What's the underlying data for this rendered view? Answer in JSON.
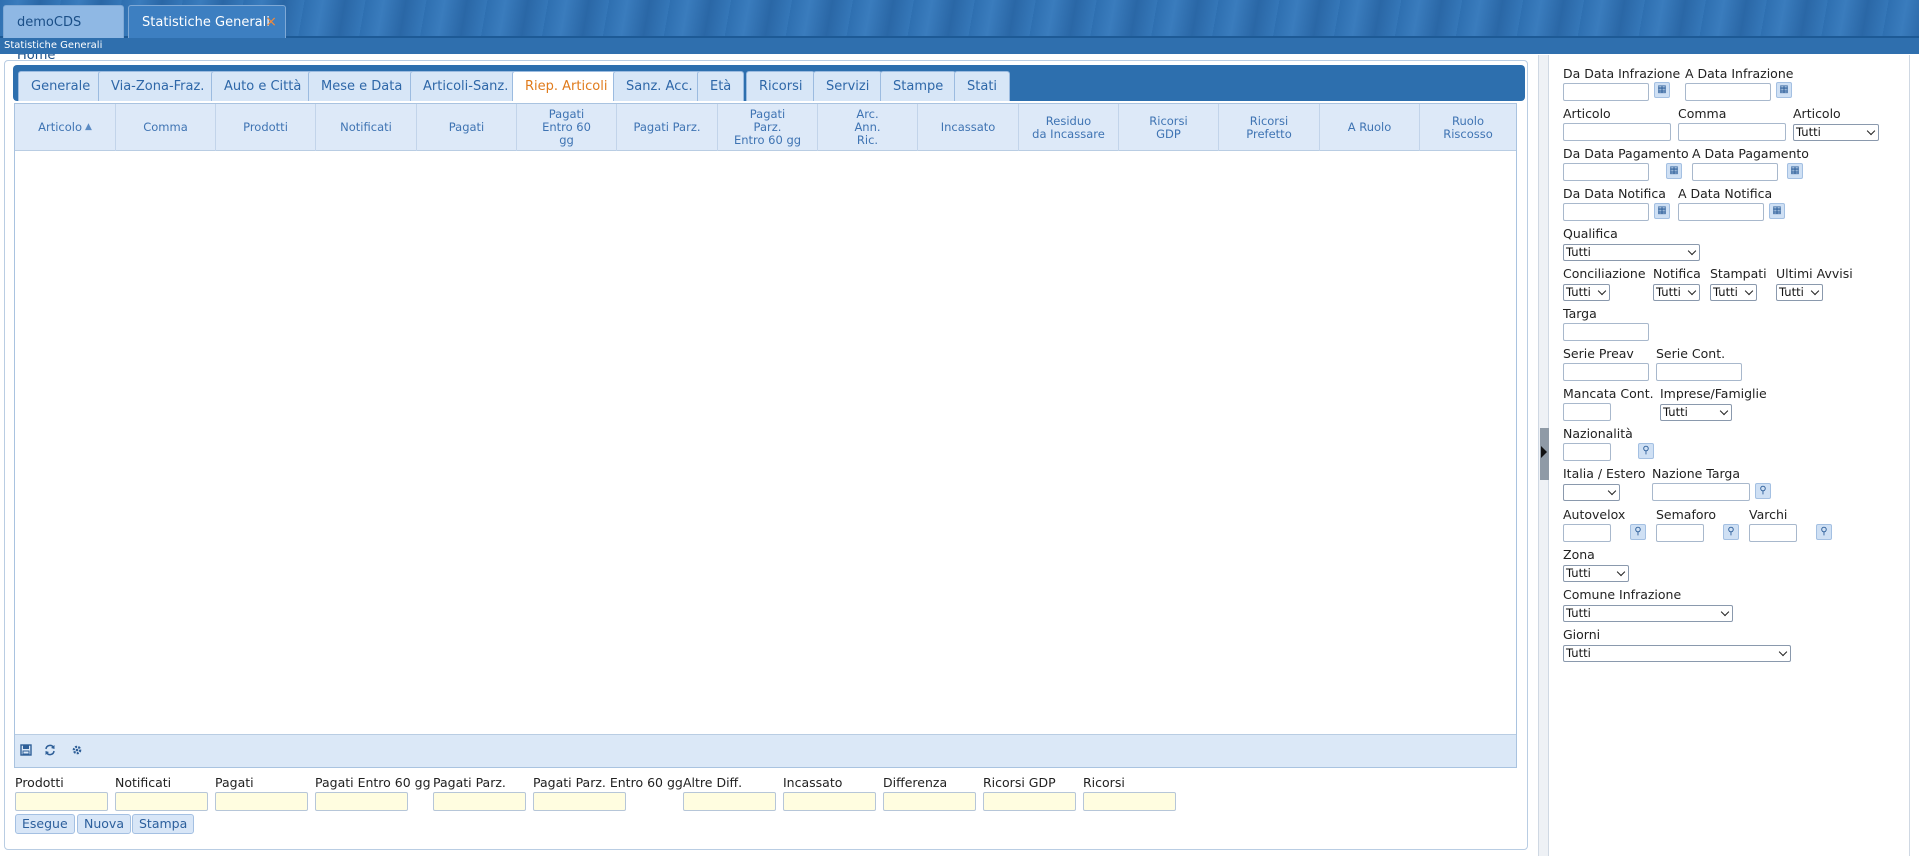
{
  "top_tabs": [
    {
      "label": "demoCDS Home"
    },
    {
      "label": "Statistiche Generali",
      "close": "×"
    }
  ],
  "subtitle": "Statistiche Generali",
  "inner_tabs": [
    {
      "label": "Generale"
    },
    {
      "label": "Via-Zona-Fraz."
    },
    {
      "label": "Auto e Città"
    },
    {
      "label": "Mese e Data"
    },
    {
      "label": "Articoli-Sanz."
    },
    {
      "label": "Riep. Articoli"
    },
    {
      "label": "Sanz. Acc."
    },
    {
      "label": "Età"
    },
    {
      "label": "Ricorsi"
    },
    {
      "label": "Servizi"
    },
    {
      "label": "Stampe"
    },
    {
      "label": "Stati"
    }
  ],
  "active_tab": "Riep. Articoli",
  "columns": [
    {
      "label": "Articolo",
      "sort": "▲▼"
    },
    {
      "label": "Comma"
    },
    {
      "label": "Prodotti"
    },
    {
      "label": "Notificati"
    },
    {
      "label": "Pagati"
    },
    {
      "label": "Pagati\nEntro 60\ngg"
    },
    {
      "label": "Pagati Parz."
    },
    {
      "label": "Pagati\nParz.\nEntro 60 gg"
    },
    {
      "label": "Arc.\nAnn.\nRic."
    },
    {
      "label": "Incassato"
    },
    {
      "label": "Residuo\nda Incassare"
    },
    {
      "label": "Ricorsi\nGDP"
    },
    {
      "label": "Ricorsi\nPrefetto"
    },
    {
      "label": "A Ruolo"
    },
    {
      "label": "Ruolo\nRiscosso"
    }
  ],
  "footer_icons": [
    "export-icon",
    "refresh-icon",
    "settings-icon"
  ],
  "summary_fields": [
    {
      "label": "Prodotti",
      "value": ""
    },
    {
      "label": "Notificati",
      "value": ""
    },
    {
      "label": "Pagati",
      "value": ""
    },
    {
      "label": "Pagati Entro 60 gg",
      "value": ""
    },
    {
      "label": "Pagati Parz.",
      "value": ""
    },
    {
      "label": "Pagati Parz. Entro 60 gg",
      "value": ""
    },
    {
      "label": "Altre Diff.",
      "value": ""
    },
    {
      "label": "Incassato",
      "value": ""
    },
    {
      "label": "Differenza",
      "value": ""
    },
    {
      "label": "Ricorsi GDP",
      "value": ""
    },
    {
      "label": "Ricorsi",
      "value": ""
    }
  ],
  "buttons": {
    "esegue": "Esegue",
    "nuova": "Nuova",
    "stampa": "Stampa"
  },
  "filters": {
    "da_data_infrazione": "Da Data Infrazione",
    "a_data_infrazione": "A Data Infrazione",
    "articolo_input": "Articolo",
    "comma": "Comma",
    "articolo_select": "Articolo",
    "articolo_select_value": "Tutti",
    "da_data_pagamento": "Da Data Pagamento",
    "a_data_pagamento": "A Data Pagamento",
    "da_data_notifica": "Da Data Notifica",
    "a_data_notifica": "A Data Notifica",
    "qualifica": "Qualifica",
    "qualifica_value": "Tutti",
    "conciliazione": "Conciliazione",
    "conciliazione_value": "Tutti",
    "notifica": "Notifica",
    "notifica_value": "Tutti",
    "stampati": "Stampati",
    "stampati_value": "Tutti",
    "ultimi_avvisi": "Ultimi Avvisi",
    "ultimi_avvisi_value": "Tutti",
    "targa": "Targa",
    "serie_preav": "Serie Preav",
    "serie_cont": "Serie Cont.",
    "mancata_cont": "Mancata Cont.",
    "imprese_famiglie": "Imprese/Famiglie",
    "imprese_famiglie_value": "Tutti",
    "nazionalita": "Nazionalità",
    "italia_estero": "Italia / Estero",
    "italia_estero_value": "",
    "nazione_targa": "Nazione Targa",
    "autovelox": "Autovelox",
    "semaforo": "Semaforo",
    "varchi": "Varchi",
    "zona": "Zona",
    "zona_value": "Tutti",
    "comune_infrazione": "Comune Infrazione",
    "comune_infrazione_value": "Tutti",
    "giorni": "Giorni",
    "giorni_value": "Tutti"
  },
  "colors": {
    "accent": "#2d6fae",
    "active_tab_text": "#e07b1c",
    "header_bg": "#dde9f8",
    "summary_input_bg": "#fffde0"
  }
}
